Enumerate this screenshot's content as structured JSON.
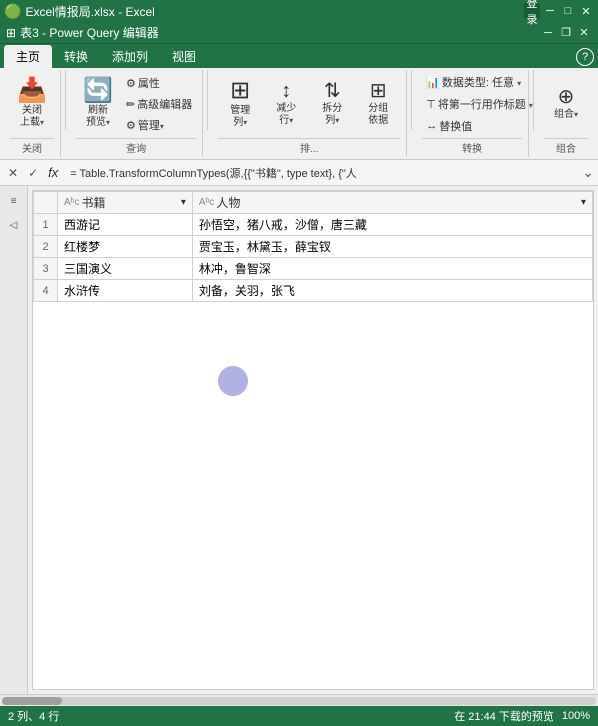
{
  "excel_title": {
    "text": "Excel情报局.xlsx - Excel",
    "login_btn": "登录",
    "min_btn": "─",
    "max_btn": "□",
    "close_btn": "✕"
  },
  "pq_title": {
    "text": "表3 - Power Query 编辑器",
    "min_btn": "─",
    "restore_btn": "❐",
    "close_btn": "✕"
  },
  "tabs": [
    {
      "label": "主页",
      "active": true
    },
    {
      "label": "转换",
      "active": false
    },
    {
      "label": "添加列",
      "active": false
    },
    {
      "label": "视图",
      "active": false
    }
  ],
  "ribbon": {
    "groups": [
      {
        "name": "关闭",
        "buttons": [
          {
            "icon": "📥",
            "label": "关闭\n上载▾"
          }
        ]
      },
      {
        "name": "查询",
        "buttons": [
          {
            "icon": "🔄",
            "label": "刷新\n预览▾"
          },
          {
            "icon": "⚙",
            "label": "属性"
          },
          {
            "icon": "✏",
            "label": "高级编辑器"
          },
          {
            "icon": "⚙",
            "label": "管理▾"
          }
        ]
      },
      {
        "name": "排...",
        "buttons": [
          {
            "icon": "⊞",
            "label": "管理\n列▾"
          },
          {
            "icon": "↕",
            "label": "减少\n行▾"
          },
          {
            "icon": "↕",
            "label": "拆分\n列▾"
          },
          {
            "icon": "⊞",
            "label": "分组\n依据"
          }
        ]
      },
      {
        "name": "转换",
        "right_items": [
          "数据类型: 任意 ▾",
          "将第一行用作标题 ▾",
          "↔替换值"
        ]
      }
    ],
    "group_btn": "组合▾"
  },
  "formula_bar": {
    "cancel": "✕",
    "confirm": "✓",
    "fx": "fx",
    "content": "= Table.TransformColumnTypes(源,{{\"书籍\", type text}, {\"人",
    "expand": "⌄"
  },
  "table": {
    "columns": [
      {
        "type": "Aᵇc",
        "name": "书籍",
        "has_filter": true
      },
      {
        "type": "Aᵇc",
        "name": "人物",
        "has_filter": true
      }
    ],
    "rows": [
      {
        "num": 1,
        "col1": "西游记",
        "col2": "孙悟空，猪八戒，沙僧，唐三藏"
      },
      {
        "num": 2,
        "col1": "红楼梦",
        "col2": "贾宝玉，林黛玉，薛宝钗"
      },
      {
        "num": 3,
        "col1": "三国演义",
        "col2": "林冲，鲁智深"
      },
      {
        "num": 4,
        "col1": "水浒传",
        "col2": "刘备，关羽，张飞"
      }
    ]
  },
  "status_bar": {
    "left": "2 列、4 行",
    "right": "在 21:44 下载的预览",
    "zoom": "100%"
  },
  "scrollbar": {
    "label": "scrollbar"
  }
}
